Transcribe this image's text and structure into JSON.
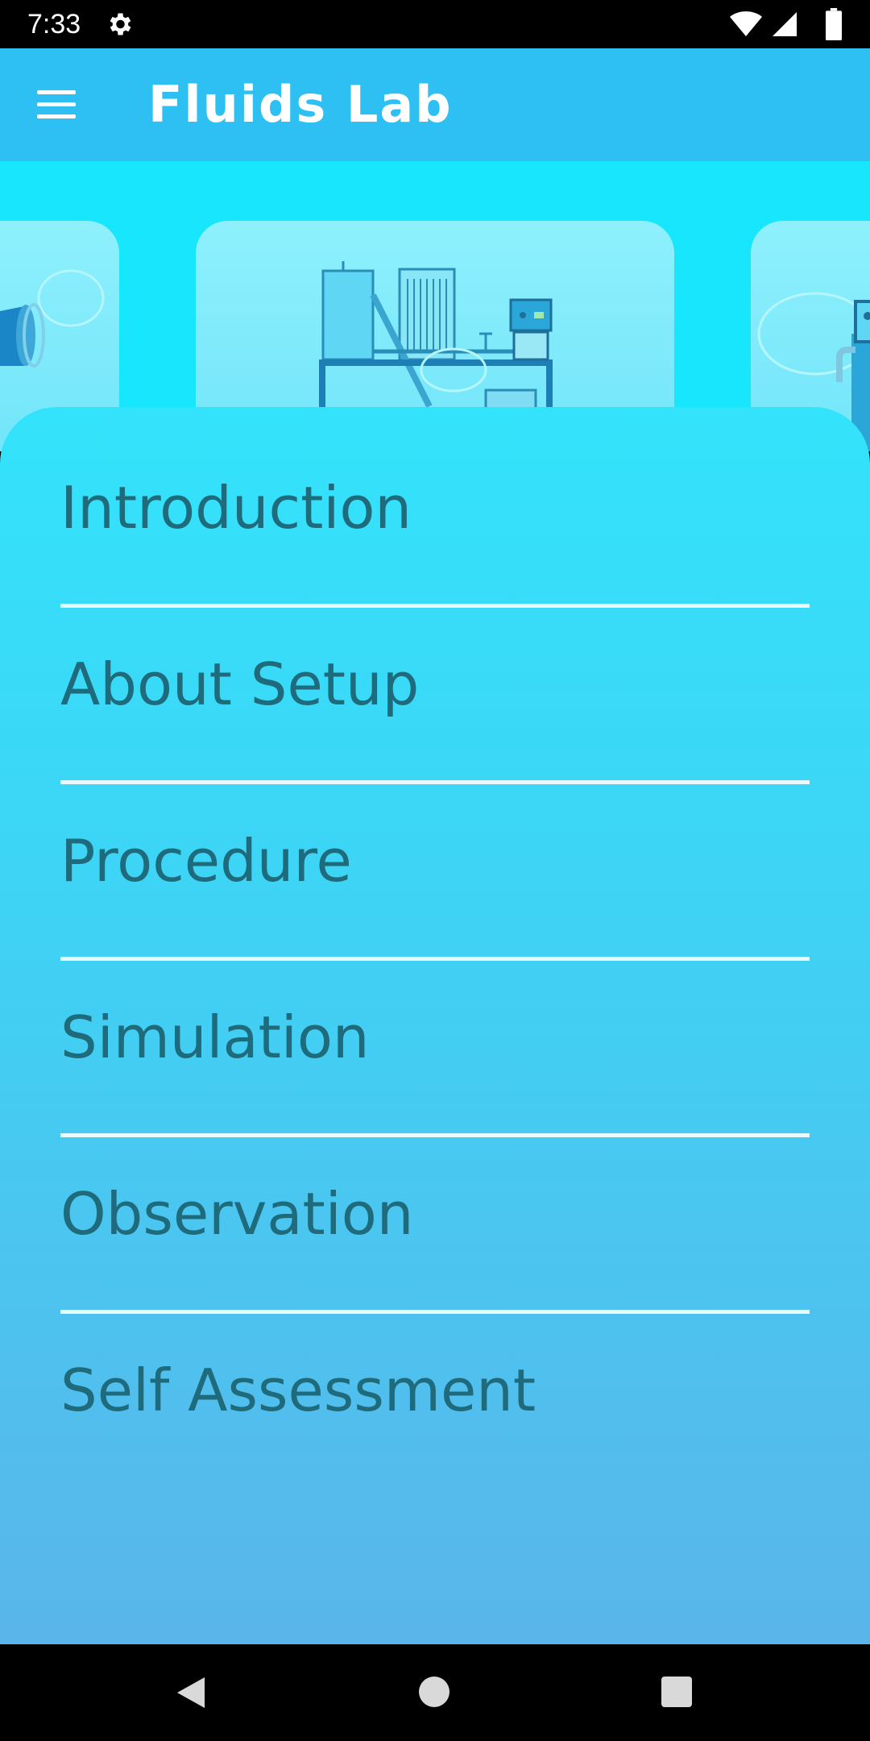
{
  "status_bar": {
    "time": "7:33",
    "icons": [
      "settings-gear-icon",
      "wifi-icon",
      "cell-signal-icon",
      "battery-icon"
    ]
  },
  "app_bar": {
    "title": "Fluids Lab",
    "menu_icon": "hamburger-menu-icon",
    "background": "#2ec0f2"
  },
  "carousel": {
    "background": "#17e6fc",
    "cards": [
      "pipe-apparatus-illustration",
      "fluid-test-rig-illustration",
      "pump-setup-illustration"
    ]
  },
  "menu": {
    "text_color": "#1f6b7c",
    "items": [
      {
        "label": "Introduction"
      },
      {
        "label": "About Setup"
      },
      {
        "label": "Procedure"
      },
      {
        "label": "Simulation"
      },
      {
        "label": "Observation"
      },
      {
        "label": "Self Assessment"
      }
    ]
  },
  "nav_bar": {
    "buttons": [
      "back-icon",
      "home-icon",
      "recents-icon"
    ]
  }
}
